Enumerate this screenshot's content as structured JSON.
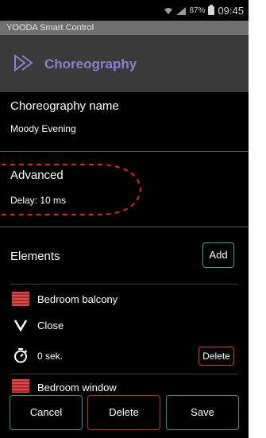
{
  "statusbar": {
    "battery": "87%",
    "time": "09:45",
    "wifi_icon": "wifi-icon",
    "signal_icon": "signal-icon",
    "battery_icon": "battery-icon"
  },
  "app": {
    "name": "YOODA Smart Control"
  },
  "header": {
    "title": "Choreography",
    "icon": "choreography-icon",
    "accent": "#8a7fd0"
  },
  "name_section": {
    "label": "Choreography name",
    "value": "Moody Evening"
  },
  "advanced": {
    "label": "Advanced",
    "value": "Delay: 10 ms"
  },
  "elements": {
    "label": "Elements",
    "add_label": "Add",
    "items": [
      {
        "name": "Bedroom balcony",
        "icon": "blind-icon",
        "action": "Close",
        "action_icon": "chevron-down-icon",
        "delay": "0 sek.",
        "delay_icon": "timer-icon",
        "delete_label": "Delete"
      },
      {
        "name": "Bedroom window",
        "icon": "blind-icon"
      }
    ]
  },
  "footer": {
    "cancel": "Cancel",
    "delete": "Delete",
    "save": "Save"
  },
  "colors": {
    "accent_green": "#2f8f7c",
    "danger_red": "#b83434",
    "highlight_red": "#d9262a"
  }
}
